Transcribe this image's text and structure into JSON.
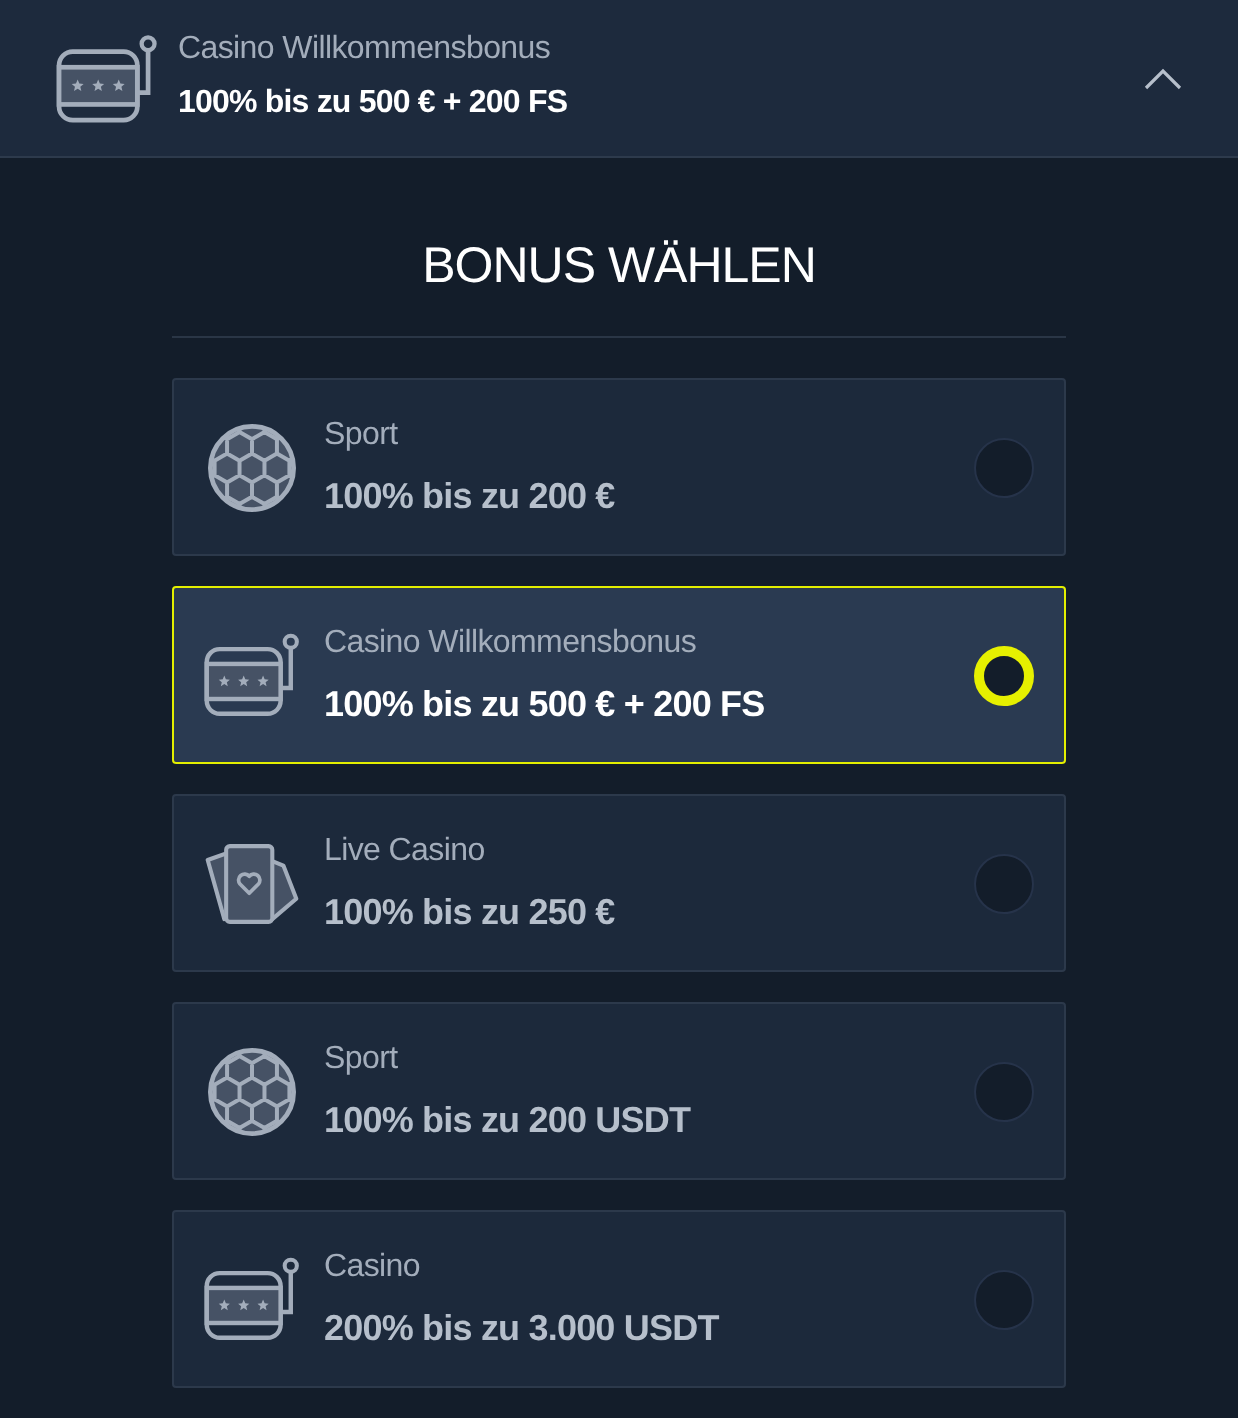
{
  "header": {
    "kind": "casino",
    "title": "Casino Willkommensbonus",
    "amount": "100% bis zu 500 € + 200 FS",
    "expanded": true
  },
  "heading": "BONUS WÄHLEN",
  "bonuses": [
    {
      "kind": "sport",
      "title": "Sport",
      "amount": "100% bis zu 200 €",
      "selected": false
    },
    {
      "kind": "casino",
      "title": "Casino Willkommensbonus",
      "amount": "100% bis zu 500 € + 200 FS",
      "selected": true
    },
    {
      "kind": "live",
      "title": "Live Casino",
      "amount": "100% bis zu 250 €",
      "selected": false
    },
    {
      "kind": "sport",
      "title": "Sport",
      "amount": "100% bis zu 200 USDT",
      "selected": false
    },
    {
      "kind": "casino",
      "title": "Casino",
      "amount": "200% bis zu 3.000 USDT",
      "selected": false
    }
  ]
}
